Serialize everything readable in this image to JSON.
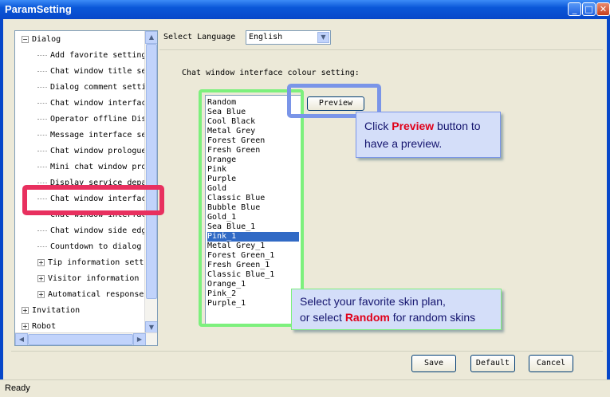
{
  "window": {
    "title": "ParamSetting",
    "min_icon": "minimize-icon",
    "max_icon": "maximize-icon",
    "close_icon": "close-icon"
  },
  "tree": {
    "items": [
      {
        "label": "Dialog",
        "type": "expanded"
      },
      {
        "label": "Add favorite setting",
        "type": "leaf"
      },
      {
        "label": "Chat window title se",
        "type": "leaf"
      },
      {
        "label": "Dialog comment setti",
        "type": "leaf"
      },
      {
        "label": "Chat window interfac",
        "type": "leaf"
      },
      {
        "label": "Operator offline Dis",
        "type": "leaf"
      },
      {
        "label": "Message interface se",
        "type": "leaf"
      },
      {
        "label": "Chat window prologue",
        "type": "leaf"
      },
      {
        "label": "Mini chat window pro",
        "type": "leaf"
      },
      {
        "label": "Display service depa",
        "type": "leaf"
      },
      {
        "label": "Chat window interfac",
        "type": "leaf"
      },
      {
        "label": "Chat window interfac",
        "type": "leaf"
      },
      {
        "label": "Chat window side edg",
        "type": "leaf"
      },
      {
        "label": "Countdown to dialog",
        "type": "leaf"
      },
      {
        "label": "Tip information sett",
        "type": "collapsed"
      },
      {
        "label": "Visitor information",
        "type": "collapsed"
      },
      {
        "label": "Automatical response",
        "type": "collapsed"
      },
      {
        "label": "Invitation",
        "type": "root-collapsed"
      },
      {
        "label": "Robot",
        "type": "root-collapsed"
      }
    ],
    "expand_glyph": "⊟",
    "collapse_glyph": "⊞"
  },
  "language": {
    "label": "Select Language",
    "value": "English"
  },
  "colour": {
    "label": "Chat window interface colour setting:",
    "options": [
      "Random",
      "Sea Blue",
      "Cool Black",
      "Metal Grey",
      "Forest Green",
      "Fresh Green",
      "Orange",
      "Pink",
      "Purple",
      "Gold",
      "Classic Blue",
      "Bubble Blue",
      "Gold_1",
      "Sea Blue_1",
      "Pink_1",
      "Metal Grey_1",
      "Forest Green_1",
      "Fresh Green_1",
      "Classic Blue_1",
      "Orange_1",
      "Pink_2",
      "Purple_1"
    ],
    "selected": "Pink_1",
    "preview_label": "Preview"
  },
  "tips": {
    "preview": {
      "before": "Click ",
      "highlight": "Preview",
      "after": " button to have a preview."
    },
    "skin": {
      "line1": "Select your favorite skin plan,",
      "before": "or select ",
      "highlight": "Random",
      "after": " for random skins"
    }
  },
  "buttons": {
    "save": "Save",
    "default": "Default",
    "cancel": "Cancel"
  },
  "status": "Ready",
  "colors": {
    "selection": "#316ac5",
    "highlight_red": "#e0001a",
    "pink_box": "#e8305f",
    "green_box": "#7df07d",
    "blue_box": "#7a95e8"
  }
}
